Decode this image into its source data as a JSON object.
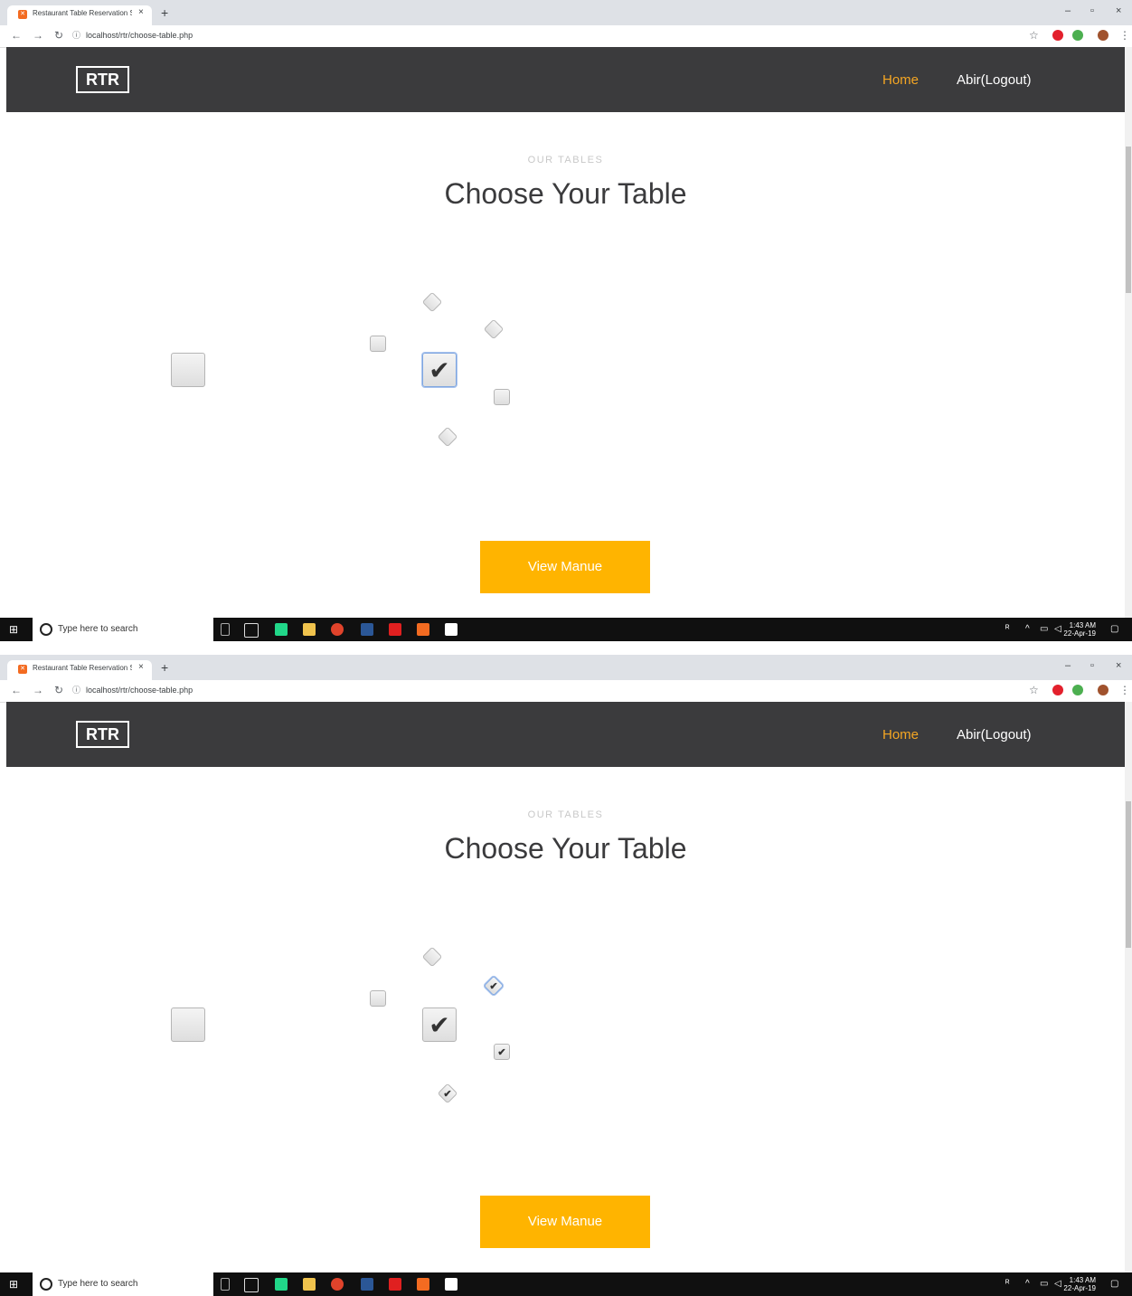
{
  "browser": {
    "tab_title": "Restaurant Table Reservation Sys",
    "tab_close": "×",
    "new_tab": "+",
    "url": "localhost/rtr/choose-table.php",
    "win_min": "–",
    "win_max": "▫",
    "win_close": "×"
  },
  "site": {
    "brand": "RTR",
    "nav_home": "Home",
    "nav_logout": "Abir(Logout)",
    "eyebrow": "OUR TABLES",
    "heading": "Choose Your Table",
    "button": "View Manue"
  },
  "taskbar": {
    "search_placeholder": "Type here to search",
    "time": "1:43 AM",
    "date": "22-Apr-19"
  },
  "tables_state_1": {
    "selected": [
      "t-center"
    ],
    "checked": [
      "t-center"
    ]
  },
  "tables_state_2": {
    "selected": [],
    "checked": [
      "t-center",
      "t-upper-right-diamond",
      "t-right-square",
      "t-bottom-diamond"
    ]
  },
  "colors": {
    "navbar": "#3b3b3d",
    "accent": "#ffb400",
    "home_link": "#f5a623"
  }
}
